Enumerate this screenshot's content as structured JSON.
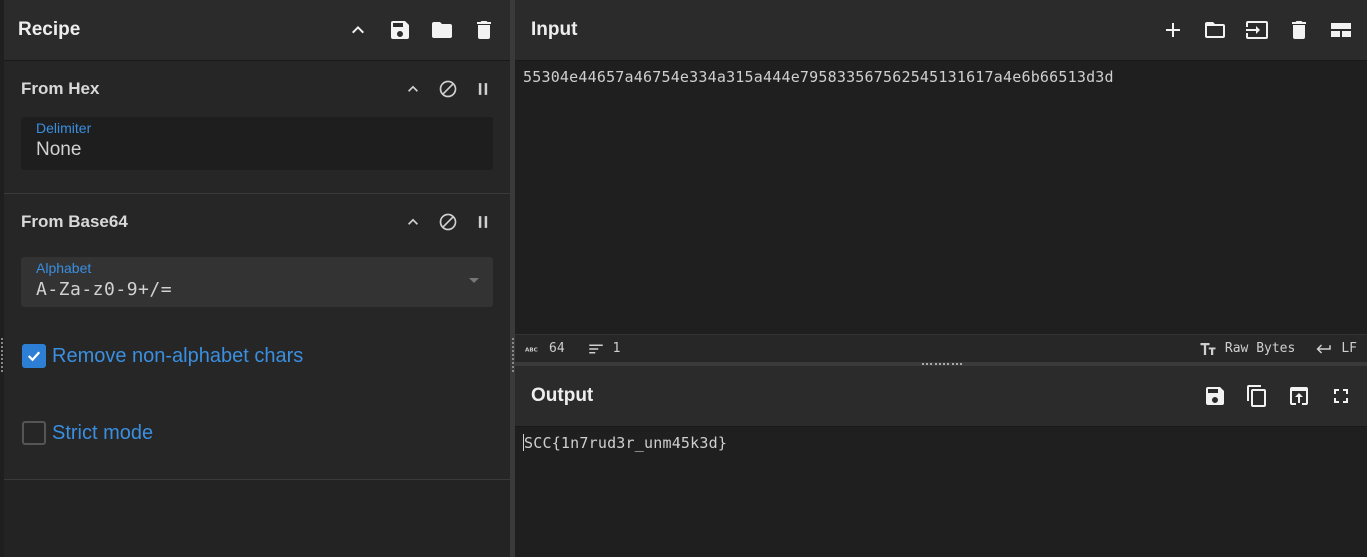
{
  "recipe": {
    "title": "Recipe",
    "header_icons": [
      "chevron-up-icon",
      "save-icon",
      "folder-icon",
      "trash-icon"
    ],
    "operations": [
      {
        "title": "From Hex",
        "field_label": "Delimiter",
        "field_value": "None"
      },
      {
        "title": "From Base64",
        "field_label": "Alphabet",
        "field_value": "A-Za-z0-9+/=",
        "checkboxes": [
          {
            "label": "Remove non-alphabet chars",
            "checked": true
          },
          {
            "label": "Strict mode",
            "checked": false
          }
        ]
      }
    ]
  },
  "input": {
    "title": "Input",
    "value": "55304e44657a46754e334a315a444e79583356756254513161 7a4e6b66513d3d",
    "status": {
      "length": "64",
      "lines": "1",
      "encoding": "Raw Bytes",
      "eol": "LF"
    }
  },
  "output": {
    "title": "Output",
    "value": "SCC{1n7rud3r_unm45k3d}"
  },
  "colors": {
    "accent": "#2d7fd6",
    "label_blue": "#3a8fe0",
    "header_bg": "#2b2b2b",
    "pane_bg": "#1f1f1f"
  }
}
